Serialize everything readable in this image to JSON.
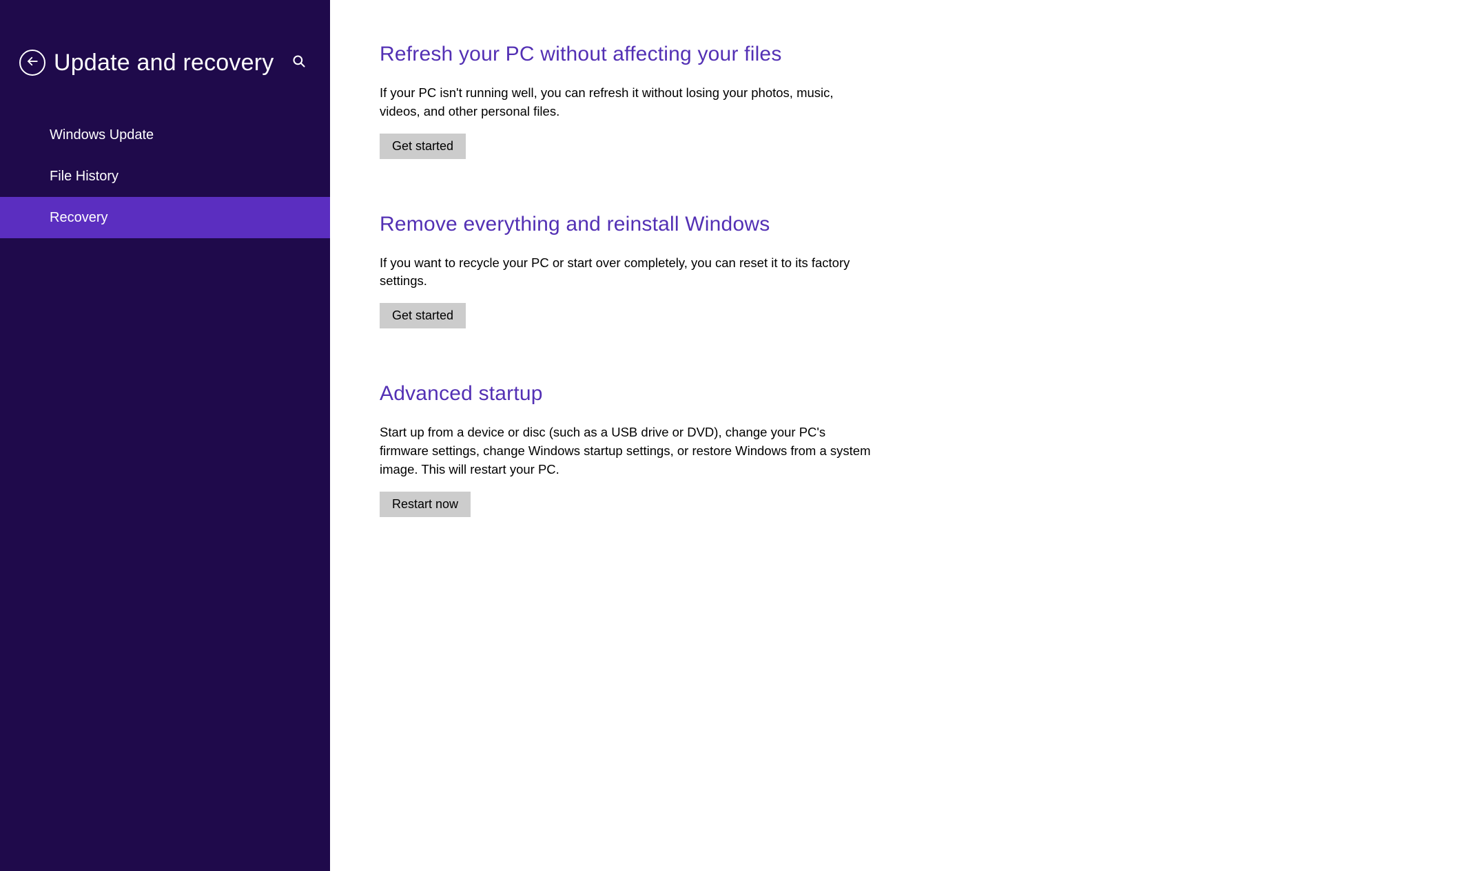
{
  "header": {
    "title": "Update and recovery"
  },
  "sidebar": {
    "items": [
      {
        "label": "Windows Update",
        "active": false
      },
      {
        "label": "File History",
        "active": false
      },
      {
        "label": "Recovery",
        "active": true
      }
    ]
  },
  "sections": [
    {
      "heading": "Refresh your PC without affecting your files",
      "body": "If your PC isn't running well, you can refresh it without losing your photos, music, videos, and other personal files.",
      "button": "Get started"
    },
    {
      "heading": "Remove everything and reinstall Windows",
      "body": "If you want to recycle your PC or start over completely, you can reset it to its factory settings.",
      "button": "Get started"
    },
    {
      "heading": "Advanced startup",
      "body": "Start up from a device or disc (such as a USB drive or DVD), change your PC's firmware settings, change Windows startup settings, or restore Windows from a system image. This will restart your PC.",
      "button": "Restart now"
    }
  ],
  "colors": {
    "sidebar_bg": "#1f0a4b",
    "sidebar_active": "#5b2ec0",
    "heading": "#5330b4",
    "button_bg": "#cccccc"
  }
}
